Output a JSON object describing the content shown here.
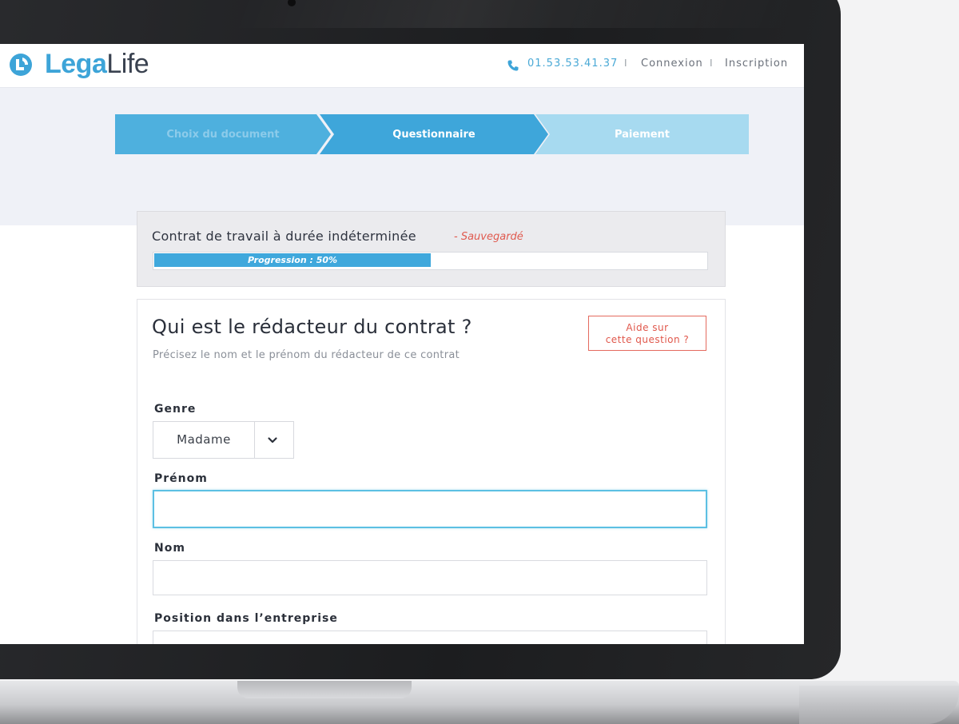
{
  "header": {
    "logo_part1": "Lega",
    "logo_part2": "Life",
    "phone": "01.53.53.41.37",
    "separator": "I",
    "login": "Connexion",
    "signup": "Inscription"
  },
  "steps": [
    {
      "label": "Choix du document",
      "state": "done"
    },
    {
      "label": "Questionnaire",
      "state": "active"
    },
    {
      "label": "Paiement",
      "state": "upcoming"
    }
  ],
  "document": {
    "title": "Contrat de travail à durée indéterminée",
    "status": "- Sauvegardé",
    "progress_text": "Progression : 50%",
    "progress_fraction": 0.5
  },
  "question": {
    "title": "Qui est le rédacteur du contrat ?",
    "subtitle": "Précisez le nom et le prénom du rédacteur de ce contrat",
    "help_line1": "Aide sur",
    "help_line2": "cette question ?",
    "fields": {
      "genre_label": "Genre",
      "genre_value": "Madame",
      "prenom_label": "Prénom",
      "prenom_value": "",
      "nom_label": "Nom",
      "nom_value": "",
      "position_label": "Position dans l’entreprise",
      "position_value": ""
    }
  },
  "colors": {
    "accent": "#3ea6da",
    "warning": "#e05a4f",
    "step_upcoming": "#a7daf0"
  },
  "icons": {
    "logo": "legalife-logo-icon",
    "phone": "phone-icon",
    "select_arrow": "chevron-down-icon"
  }
}
